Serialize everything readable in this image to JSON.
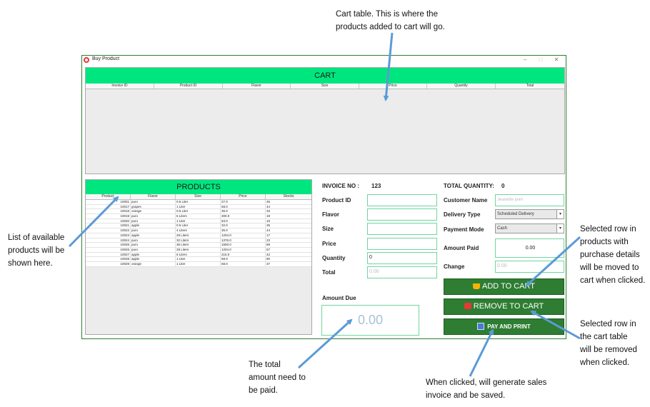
{
  "annotations": {
    "cart_note": [
      "Cart table. This is where the",
      "products added to cart will go."
    ],
    "products_note": [
      "List of available",
      "products will be",
      "shown here."
    ],
    "add_note": [
      "Selected row in",
      "products with",
      "purchase details",
      "will be moved to",
      "cart when clicked."
    ],
    "remove_note": [
      "Selected row in",
      "the cart table",
      "will be removed",
      "when clicked."
    ],
    "amount_note": [
      "The total",
      "amount need to",
      "be paid."
    ],
    "pay_note": [
      "When clicked, will generate sales",
      "invoice and be saved."
    ]
  },
  "window": {
    "title": "Buy Product",
    "minimize": "–",
    "maximize": "□",
    "close": "✕"
  },
  "cart": {
    "title": "CART",
    "columns": [
      "Invoice ID",
      "Product ID",
      "Flavor",
      "Size",
      "Price",
      "Quantity",
      "Total"
    ]
  },
  "products": {
    "title": "PRODUCTS",
    "columns": [
      "Product",
      "Flavor",
      "Size",
      "Price",
      "Stocks"
    ],
    "rows": [
      [
        "10001",
        "puro",
        "0.5 Liter",
        "27.0",
        "46"
      ],
      [
        "10017",
        "grapes",
        "1 Liter",
        "58.0",
        "44"
      ],
      [
        "10018",
        "orange",
        "0.5 Liter",
        "35.0",
        "33"
      ],
      [
        "10019",
        "puro",
        "6 Liters",
        "300.0",
        "19"
      ],
      [
        "10020",
        "puro",
        "1 Liter",
        "53.0",
        "10"
      ],
      [
        "10021",
        "apple",
        "0.5 Liter",
        "32.0",
        "35"
      ],
      [
        "10022",
        "puro",
        "4 Liters",
        "35.0",
        "44"
      ],
      [
        "10023",
        "apple",
        "28 Liters",
        "1204.0",
        "17"
      ],
      [
        "10024",
        "puro",
        "32 Liters",
        "1376.0",
        "23"
      ],
      [
        "10025",
        "puro",
        "36 Liters",
        "1500.0",
        "89"
      ],
      [
        "10026",
        "puro",
        "28 Liters",
        "1204.0",
        "67"
      ],
      [
        "10027",
        "apple",
        "6 Liters",
        "215.0",
        "42"
      ],
      [
        "10028",
        "apple",
        "1 Liter",
        "58.0",
        "80"
      ],
      [
        "10029",
        "orange",
        "1 Liter",
        "58.0",
        "37"
      ]
    ]
  },
  "form": {
    "invoice_label": "INVOICE NO :",
    "invoice_value": "123",
    "product_id_label": "Product ID",
    "flavor_label": "Flavor",
    "size_label": "Size",
    "price_label": "Price",
    "quantity_label": "Quantity",
    "quantity_value": "0",
    "total_label": "Total",
    "total_placeholder": "0.00",
    "total_quantity_label": "TOTAL QUANTITY:",
    "total_quantity_value": "0",
    "customer_name_label": "Customer Name",
    "customer_name_placeholder": "Jeanette joen",
    "delivery_type_label": "Delivery Type",
    "delivery_type_value": "Scheduled Delivery",
    "payment_mode_label": "Payment Mode",
    "payment_mode_value": "Cash",
    "amount_paid_label": "Amount Paid",
    "amount_paid_value": "0.00",
    "change_label": "Change",
    "change_placeholder": "0.00",
    "amount_due_label": "Amount Due",
    "amount_due_value": "0.00"
  },
  "buttons": {
    "add_to_cart": "ADD TO CART",
    "remove_to_cart": "REMOVE TO CART",
    "pay_and_print": "PAY AND PRINT"
  },
  "colors": {
    "header_green": "#00e67e",
    "button_green": "#2e7d32",
    "arrow_blue": "#5b9bd5",
    "input_border": "#6ed6a0"
  }
}
